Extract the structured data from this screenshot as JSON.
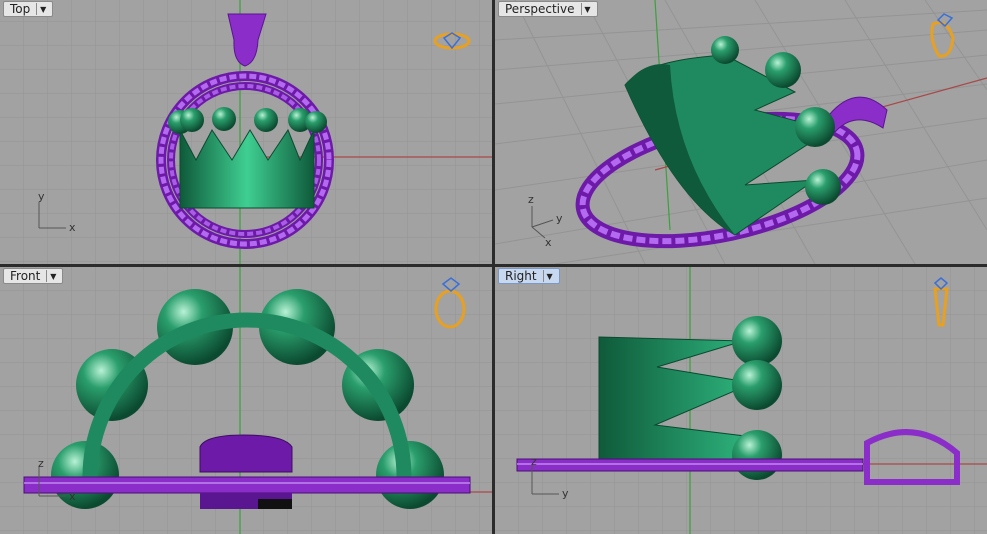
{
  "viewports": {
    "top": {
      "label": "Top",
      "dropdown_icon": "chevron-down-icon",
      "axes": [
        "y",
        "x"
      ]
    },
    "perspective": {
      "label": "Perspective",
      "dropdown_icon": "chevron-down-icon",
      "axes": [
        "z",
        "y",
        "x"
      ]
    },
    "front": {
      "label": "Front",
      "dropdown_icon": "chevron-down-icon",
      "axes": [
        "z",
        "x"
      ]
    },
    "right": {
      "label": "Right",
      "dropdown_icon": "chevron-down-icon",
      "axes": [
        "z",
        "y"
      ],
      "active": true
    }
  },
  "colors": {
    "viewport_bg": "#a2a2a2",
    "grid_minor": "#949494",
    "grid_major": "#858585",
    "axis_x": "#a84848",
    "axis_y": "#3ca03c",
    "crown_green": "#1f8a5f",
    "bezel_purple": "#7a1fb8",
    "gizmo_orange": "#e8a020",
    "gizmo_blue": "#3a6fd8"
  }
}
